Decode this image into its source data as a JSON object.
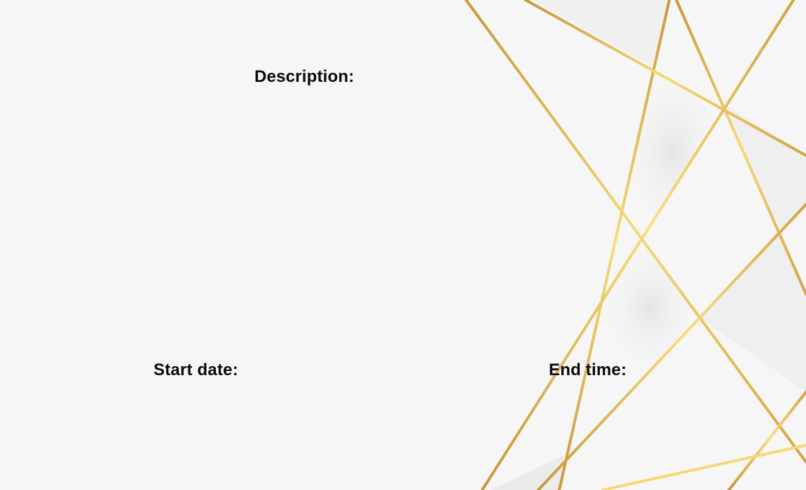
{
  "form": {
    "description_label": "Description:",
    "start_date_label": "Start date:",
    "end_time_label": "End time:"
  },
  "theme": {
    "background": "#f6f6f6",
    "gold_dark": "#c9973b",
    "gold_light": "#f5d977",
    "text": "#0a0a0a"
  },
  "decoration": {
    "icon": "gold-geometric-lines"
  }
}
